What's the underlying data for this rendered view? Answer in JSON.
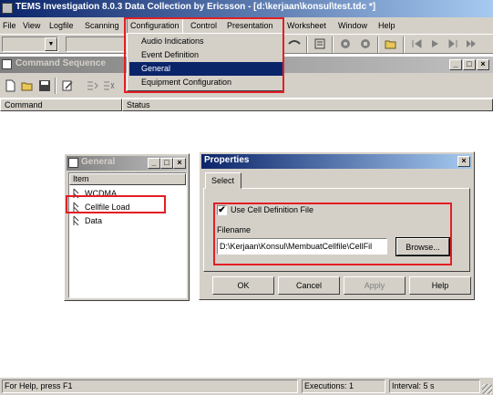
{
  "app": {
    "title": "TEMS Investigation 8.0.3 Data Collection by Ericsson - [d:\\kerjaan\\konsul\\test.tdc *]"
  },
  "menubar": {
    "items": [
      "File",
      "View",
      "Logfile",
      "Scanning",
      "Configuration",
      "Control",
      "Presentation",
      "Worksheet",
      "Window",
      "Help"
    ]
  },
  "config_menu": {
    "items": [
      "Audio Indications",
      "Event Definition",
      "General",
      "Equipment Configuration"
    ],
    "selected_index": 2
  },
  "cmdseq": {
    "title": "Command Sequence",
    "columns": [
      "Command",
      "Status"
    ]
  },
  "general_win": {
    "title": "General",
    "header": "Item",
    "items": [
      "WCDMA",
      "Cellfile Load",
      "Data"
    ]
  },
  "properties": {
    "title": "Properties",
    "tab": "Select",
    "checkbox_label": "Use Cell Definition File",
    "checkbox_checked": true,
    "filename_label": "Filename",
    "filename_value": "D:\\Kerjaan\\Konsul\\MembuatCellfile\\CellFil",
    "browse_label": "Browse...",
    "ok_label": "OK",
    "cancel_label": "Cancel",
    "apply_label": "Apply",
    "help_label": "Help"
  },
  "statusbar": {
    "help": "For Help, press F1",
    "executions": "Executions: 1",
    "interval": "Interval: 5 s"
  },
  "colors": {
    "titlebar_dark": "#0a246a",
    "titlebar_light": "#a6caf0",
    "inactive_dark": "#808080",
    "inactive_light": "#c0c0c0",
    "face": "#d4d0c8",
    "highlight_red": "#e31e24"
  }
}
